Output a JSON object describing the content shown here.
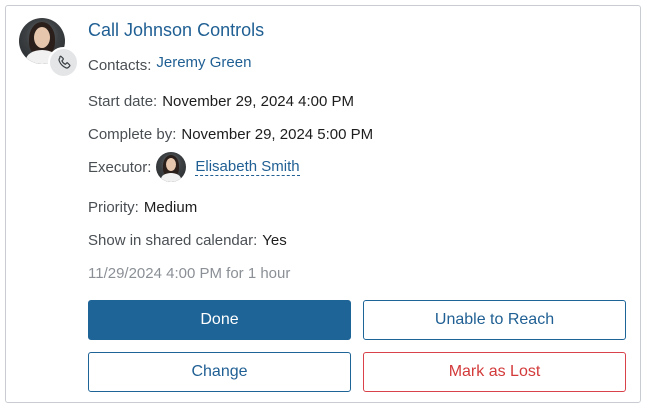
{
  "task": {
    "title": "Call Johnson Controls",
    "contacts_label": "Contacts:",
    "contacts_value": "Jeremy Green",
    "start_label": "Start date:",
    "start_value": "November 29, 2024 4:00 PM",
    "complete_label": "Complete by:",
    "complete_value": "November 29, 2024 5:00 PM",
    "executor_label": "Executor:",
    "executor_value": "Elisabeth Smith",
    "priority_label": "Priority:",
    "priority_value": "Medium",
    "calendar_label": "Show in shared calendar:",
    "calendar_value": "Yes",
    "time_summary": "11/29/2024 4:00 PM for 1 hour"
  },
  "actions": {
    "done": "Done",
    "unable": "Unable to Reach",
    "change": "Change",
    "lost": "Mark as Lost"
  },
  "icons": {
    "badge": "phone-icon"
  },
  "colors": {
    "primary": "#1f6497",
    "link": "#1f5f93",
    "danger": "#d33a3a",
    "muted": "#8b9096"
  }
}
